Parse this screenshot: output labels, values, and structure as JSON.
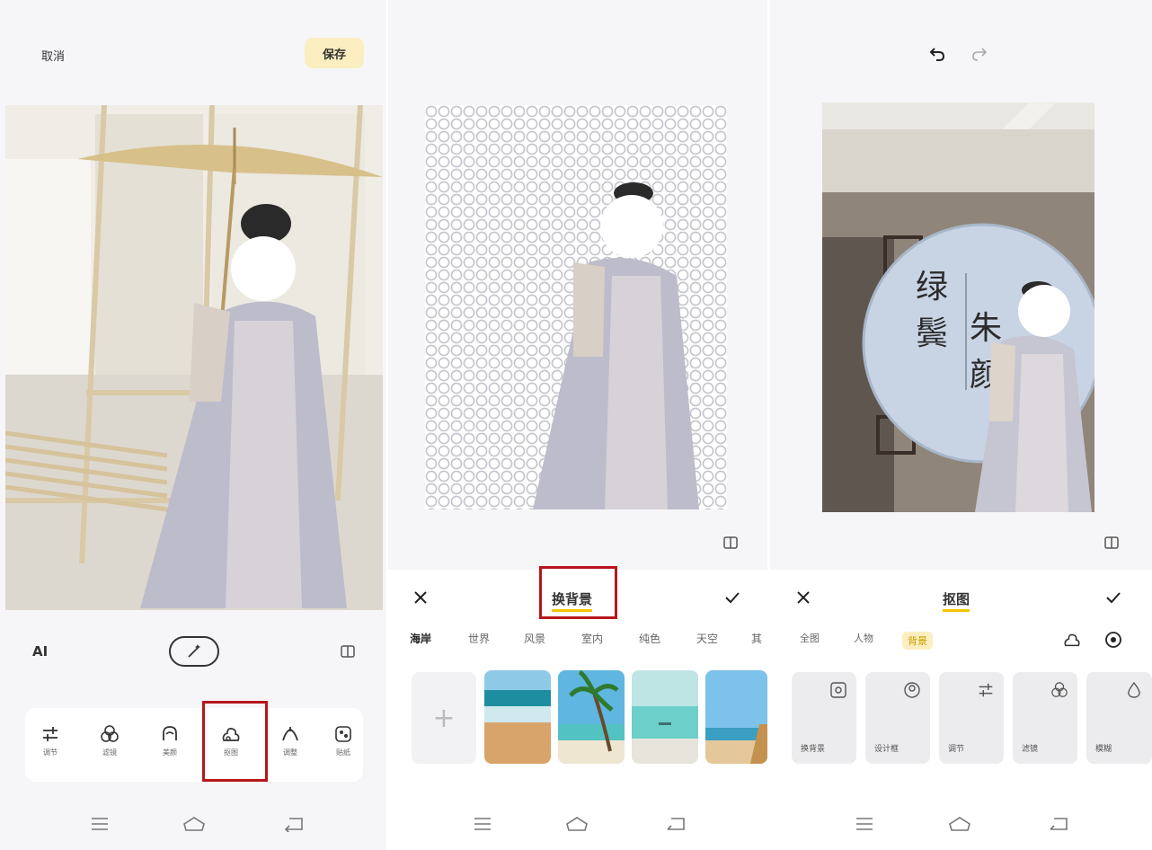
{
  "panel1": {
    "cancel_label": "取消",
    "save_label": "保存",
    "ai_label": "AI",
    "tools": [
      {
        "label": "调节",
        "icon": "sliders-icon"
      },
      {
        "label": "滤镜",
        "icon": "filter-icon"
      },
      {
        "label": "美颜",
        "icon": "face-icon"
      },
      {
        "label": "抠图",
        "icon": "cutout-icon"
      },
      {
        "label": "调整",
        "icon": "shape-icon"
      },
      {
        "label": "贴纸",
        "icon": "sticker-icon"
      }
    ],
    "highlighted_tool": "抠图"
  },
  "panel2": {
    "title": "换背景",
    "categories": [
      "海岸",
      "世界",
      "风景",
      "室内",
      "纯色",
      "天空",
      "其"
    ],
    "active_category": "海岸",
    "add_tile": "+"
  },
  "panel3": {
    "title": "抠图",
    "tabs": [
      "全图",
      "人物",
      "背景"
    ],
    "active_tab": "背景",
    "features": [
      {
        "label": "换背景",
        "icon": "image-icon"
      },
      {
        "label": "设计框",
        "icon": "portrait-icon"
      },
      {
        "label": "调节",
        "icon": "sliders-icon"
      },
      {
        "label": "滤镜",
        "icon": "filter-icon"
      },
      {
        "label": "模糊",
        "icon": "drop-icon"
      }
    ],
    "poster_text": [
      "绿",
      "鬓",
      "朱",
      "颜"
    ]
  },
  "colors": {
    "accent_yellow": "#f5c400",
    "save_bg": "#fbeec0",
    "highlight_red": "#b7161c"
  }
}
